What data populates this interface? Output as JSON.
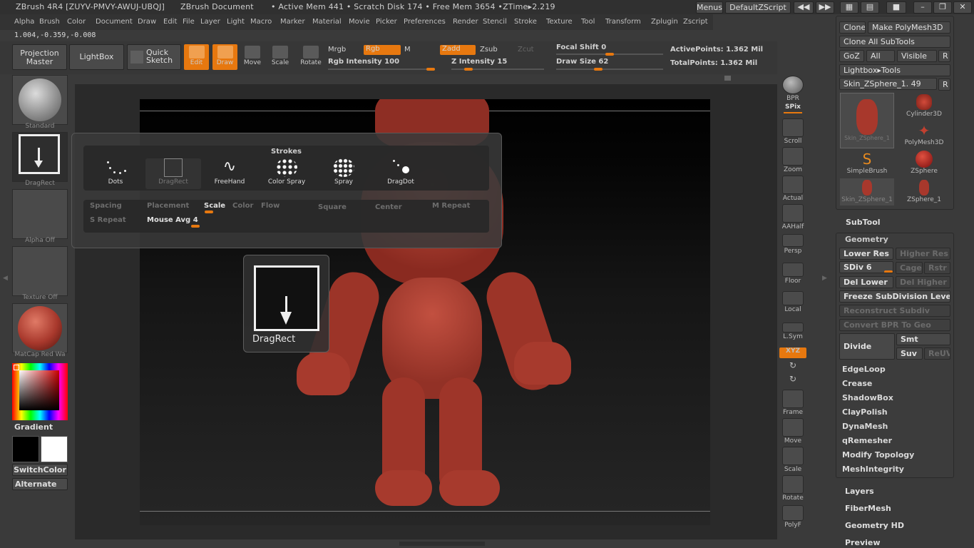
{
  "title_bar": {
    "app": "ZBrush 4R4 [ZUYV-PMVY-AWUJ-UBQJ]",
    "document": "ZBrush Document",
    "stats": "• Active Mem 441  • Scratch Disk 174  • Free Mem 3654  •ZTime▸2.219",
    "menus_button": "Menus",
    "zscript_button": "DefaultZScript"
  },
  "menu_bar": [
    "Alpha",
    "Brush",
    "Color",
    "Document",
    "Draw",
    "Edit",
    "File",
    "Layer",
    "Light",
    "Macro",
    "Marker",
    "Material",
    "Movie",
    "Picker",
    "Preferences",
    "Render",
    "Stencil",
    "Stroke",
    "Texture",
    "Tool",
    "Transform",
    "Zplugin",
    "Zscript"
  ],
  "coordinates": "1.004,-0.359,-0.008",
  "shelf": {
    "projection_master": "Projection Master",
    "lightbox": "LightBox",
    "quick_sketch": "Quick Sketch",
    "edit": "Edit",
    "draw": "Draw",
    "move": "Move",
    "scale": "Scale",
    "rotate": "Rotate",
    "mrgb": "Mrgb",
    "rgb": "Rgb",
    "m": "M",
    "zadd": "Zadd",
    "zsub": "Zsub",
    "zcut": "Zcut",
    "rgb_intensity": "Rgb Intensity 100",
    "z_intensity": "Z Intensity 15",
    "focal_shift": "Focal Shift 0",
    "draw_size": "Draw Size 62",
    "active_points": "ActivePoints: 1.362 Mil",
    "total_points": "TotalPoints: 1.362 Mil",
    "rgb_intensity_value": 100,
    "z_intensity_value": 15,
    "focal_shift_value": 0,
    "draw_size_value": 62
  },
  "left_column": {
    "brush": "Standard",
    "stroke": "DragRect",
    "alpha": "Alpha Off",
    "texture": "Texture Off",
    "material": "MatCap Red Wa",
    "gradient": "Gradient",
    "switch_color": "SwitchColor",
    "alternate": "Alternate"
  },
  "stroke_popup": {
    "title": "Strokes",
    "items": [
      "Dots",
      "DragRect",
      "FreeHand",
      "Color Spray",
      "Spray",
      "DragDot"
    ],
    "options_row1": [
      "Spacing",
      "Placement",
      "Scale",
      "Color",
      "Flow",
      "Square",
      "Center",
      "M Repeat"
    ],
    "options_row2": [
      "S Repeat",
      "Mouse Avg 4"
    ]
  },
  "drag_tooltip": "DragRect",
  "right_tools": [
    "BPR",
    "SPix",
    "Scroll",
    "Zoom",
    "Actual",
    "AAHalf",
    "Persp",
    "Floor",
    "Local",
    "L.Sym",
    "XYZ",
    "Frame",
    "Move",
    "Scale",
    "Rotate",
    "PolyF"
  ],
  "tool_panel": {
    "clone": "Clone",
    "make_polymesh": "Make PolyMesh3D",
    "clone_all": "Clone All SubTools",
    "goz": "GoZ",
    "all": "All",
    "visible": "Visible",
    "r": "R",
    "lightbox_tools": "Lightbox▸Tools",
    "current_tool": "Skin_ZSphere_1. 49",
    "current_tool_value": 49,
    "thumbs": [
      "Skin_ZSphere_1",
      "Cylinder3D",
      "PolyMesh3D",
      "SimpleBrush",
      "ZSphere",
      "Skin_ZSphere_1",
      "ZSphere_1"
    ]
  },
  "subtool_label": "SubTool",
  "geometry": {
    "title": "Geometry",
    "lower_res": "Lower Res",
    "higher_res": "Higher Res",
    "sdiv": "SDiv 6",
    "sdiv_value": 6,
    "cage": "Cage",
    "rstr": "Rstr",
    "del_lower": "Del Lower",
    "del_higher": "Del Higher",
    "freeze": "Freeze SubDivision Levels",
    "reconstruct": "Reconstruct Subdiv",
    "convert_bpr": "Convert BPR To Geo",
    "divide": "Divide",
    "smt": "Smt",
    "suv": "Suv",
    "reuv": "ReUV",
    "items": [
      "EdgeLoop",
      "Crease",
      "ShadowBox",
      "ClayPolish",
      "DynaMesh",
      "qRemesher",
      "Modify Topology",
      "MeshIntegrity"
    ]
  },
  "bottom_sections": [
    "Layers",
    "FiberMesh",
    "Geometry HD",
    "Preview"
  ],
  "colors": {
    "accent": "#e7780f",
    "panel": "#3c3c3c",
    "model": "#a8382c"
  }
}
